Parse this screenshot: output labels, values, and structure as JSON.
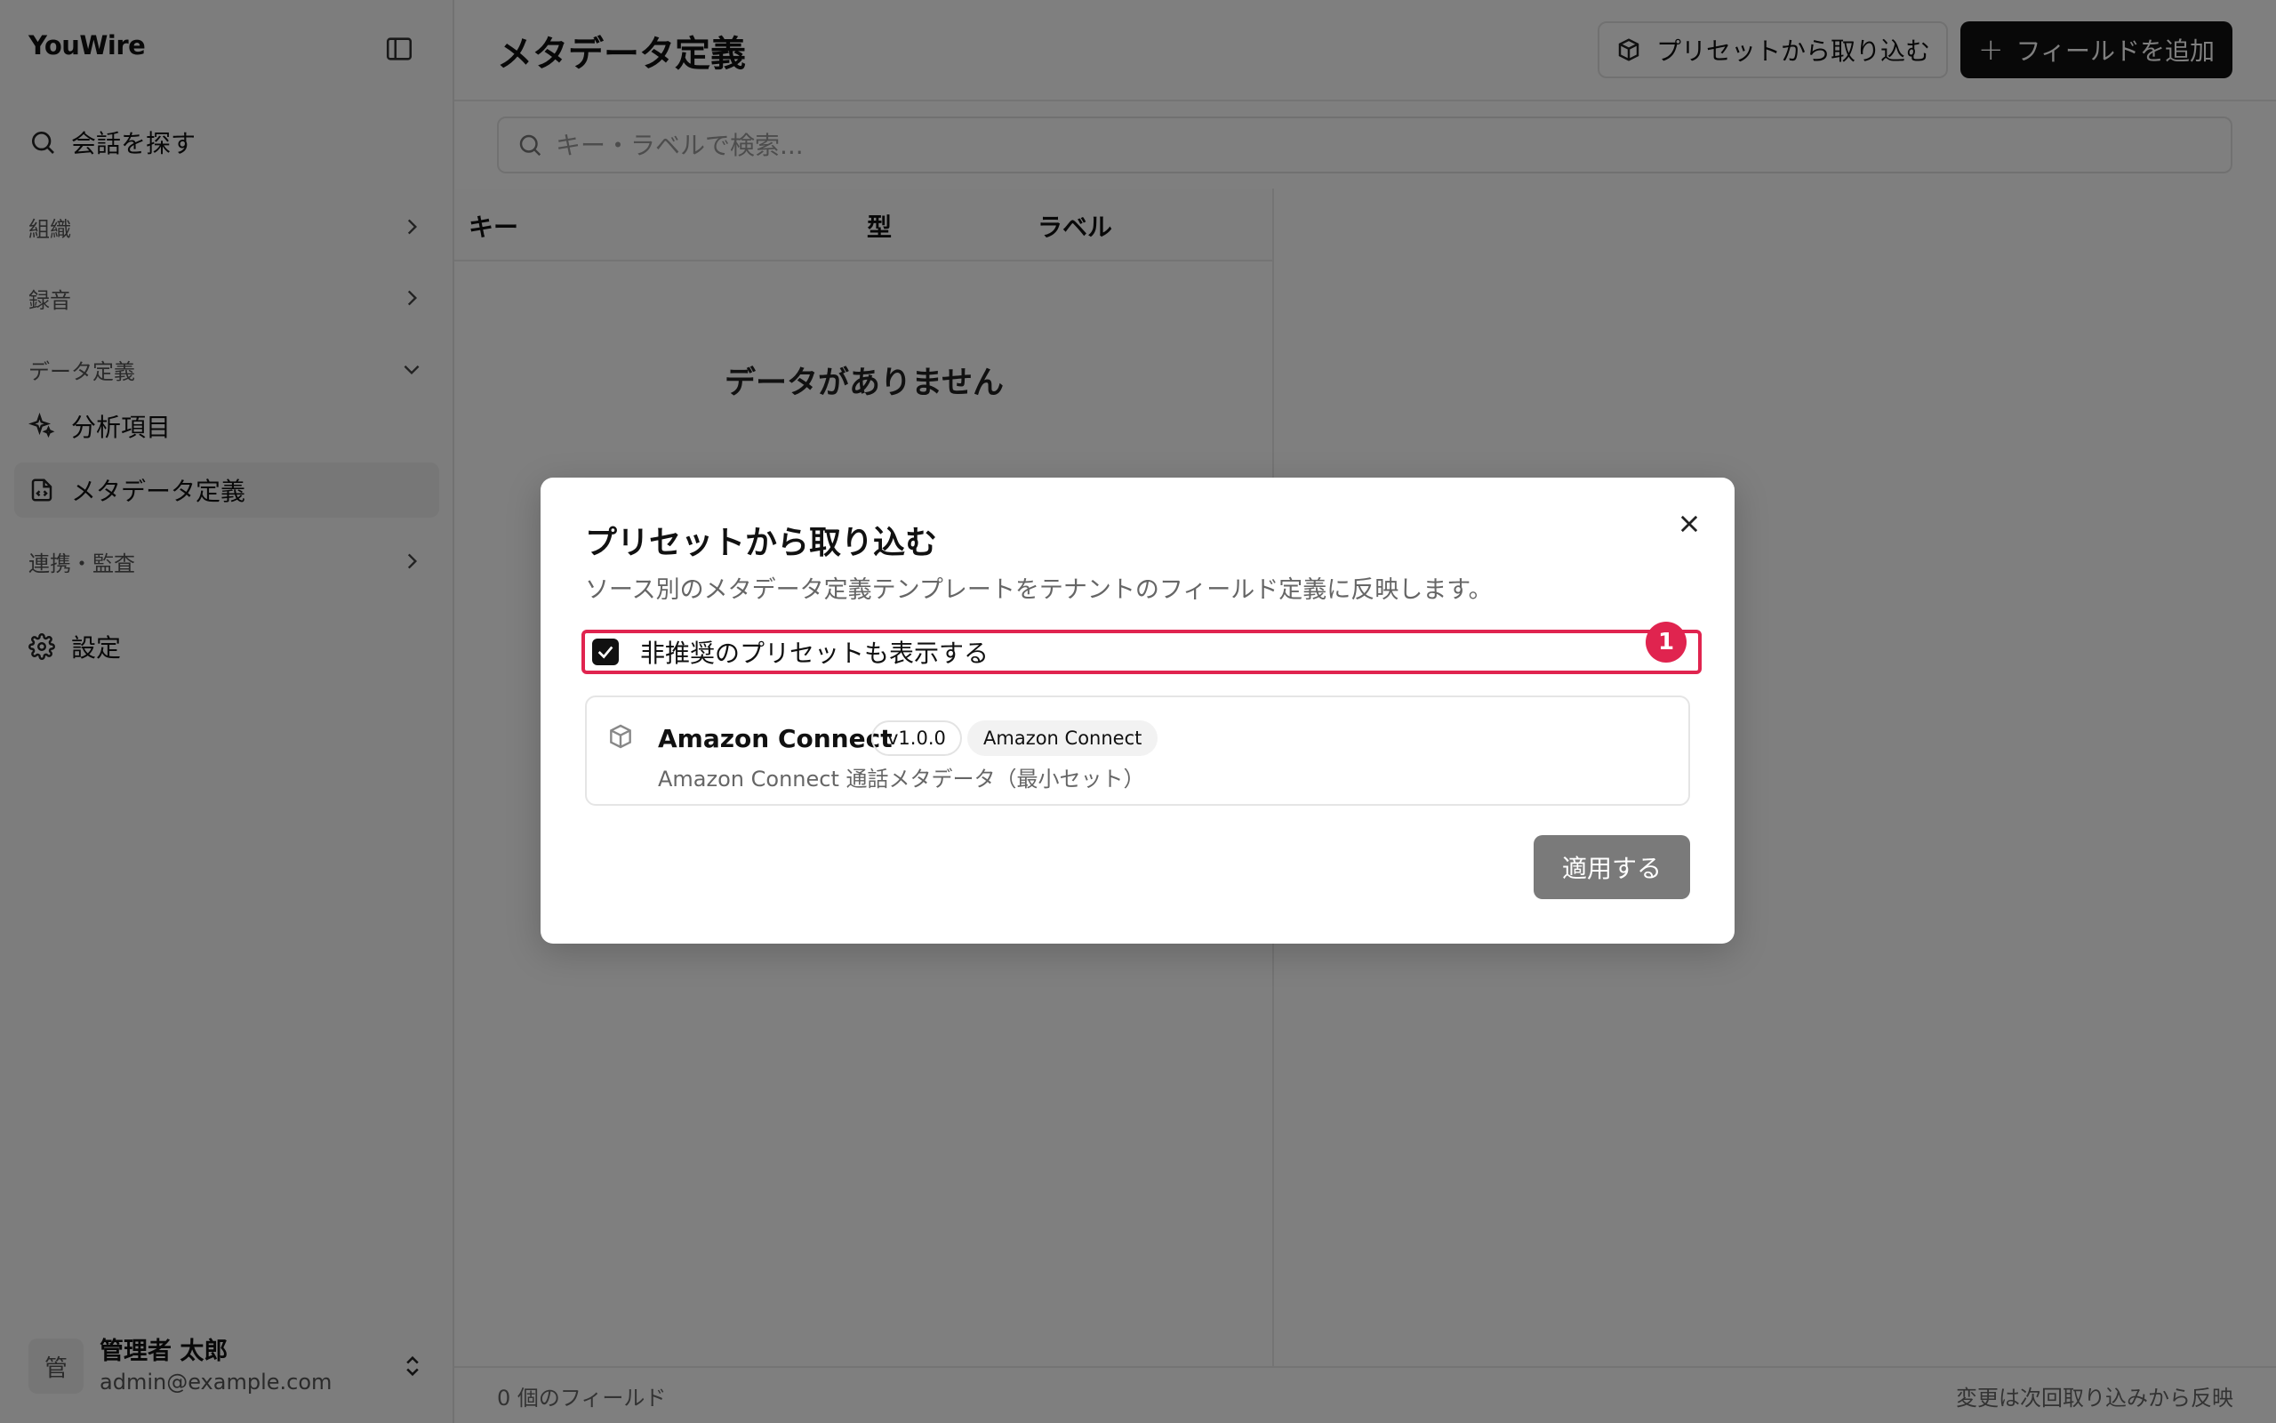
{
  "sidebar": {
    "brand": "YouWire",
    "search_label": "会話を探す",
    "groups": {
      "org": "組織",
      "recording": "録音",
      "data_def": "データ定義",
      "integration": "連携・監査"
    },
    "items": {
      "analysis": "分析項目",
      "metadata": "メタデータ定義",
      "settings": "設定"
    },
    "user": {
      "avatar_initial": "管",
      "name": "管理者 太郎",
      "email": "admin@example.com"
    }
  },
  "main": {
    "title": "メタデータ定義",
    "import_button": "プリセットから取り込む",
    "add_button": "フィールドを追加",
    "search_placeholder": "キー・ラベルで検索...",
    "columns": [
      "キー",
      "型",
      "ラベル"
    ],
    "empty_text": "データがありません",
    "footer_count": "0 個のフィールド",
    "footer_note": "変更は次回取り込みから反映"
  },
  "dialog": {
    "title": "プリセットから取り込む",
    "description": "ソース別のメタデータ定義テンプレートをテナントのフィールド定義に反映します。",
    "checkbox_label": "非推奨のプリセットも表示する",
    "checkbox_checked": true,
    "marker": "1",
    "preset": {
      "name": "Amazon Connect",
      "version": "v1.0.0",
      "source": "Amazon Connect",
      "description": "Amazon Connect 通話メタデータ（最小セット）"
    },
    "apply_button": "適用する"
  },
  "colors": {
    "accent_marker": "#e0244f",
    "primary_button": "#111111",
    "overlay": "rgba(0,0,0,0.5)"
  }
}
